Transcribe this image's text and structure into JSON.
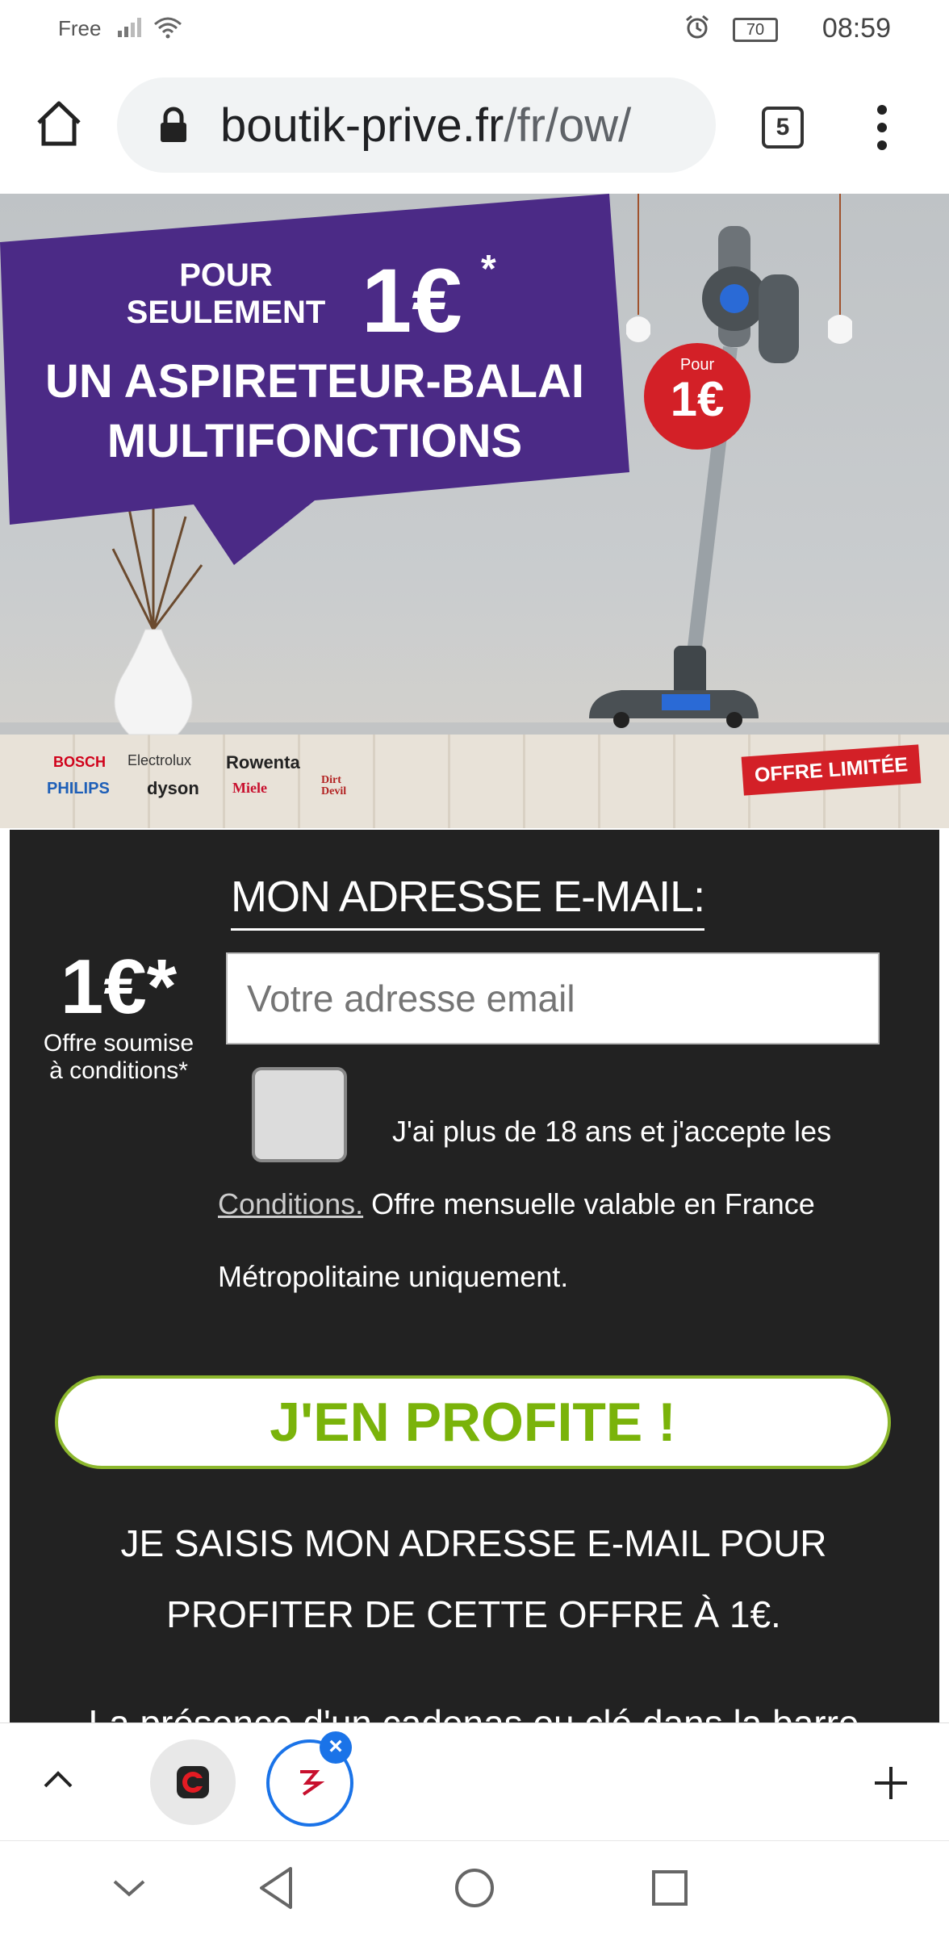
{
  "status_bar": {
    "carrier": "Free",
    "battery": "70",
    "time": "08:59"
  },
  "browser": {
    "url_host": "boutik-prive.fr",
    "url_path": "/fr/ow/",
    "tab_count": "5"
  },
  "hero": {
    "pour_seulement_line1": "POUR",
    "pour_seulement_line2": "SEULEMENT",
    "price": "1€",
    "asterisk": "*",
    "headline_line1": "UN ASPIRETEUR-BALAI",
    "headline_line2": "MULTIFONCTIONS",
    "badge_top": "Pour",
    "badge_price": "1€",
    "offer_limited": "OFFRE LIMITÉE",
    "brands": [
      "BOSCH",
      "Electrolux",
      "Rowenta",
      "PHILIPS",
      "dyson",
      "Miele",
      "Dirt Devil"
    ]
  },
  "form": {
    "label": "MON ADRESSE E-MAIL:",
    "email_placeholder": "Votre adresse email",
    "email_value": "",
    "big_price": "1€*",
    "price_note_line1": "Offre soumise",
    "price_note_line2": "à conditions*",
    "terms_line1": "J'ai plus de 18 ans et j'accepte les",
    "terms_link": "Conditions.",
    "terms_line2_rest": " Offre mensuelle valable en France",
    "terms_line3": "Métropolitaine uniquement.",
    "cta_label": "J'EN PROFITE !",
    "info_line1": "JE SAISIS MON ADRESSE E-MAIL POUR",
    "info_line2": "PROFITER DE CETTE OFFRE À 1€.",
    "cut_text": "La présence d'un cadenas ou clé dans la barre"
  },
  "colors": {
    "banner_purple": "#4b2a86",
    "accent_red": "#d32027",
    "cta_green": "#7ab30a",
    "panel_dark": "#222222"
  }
}
